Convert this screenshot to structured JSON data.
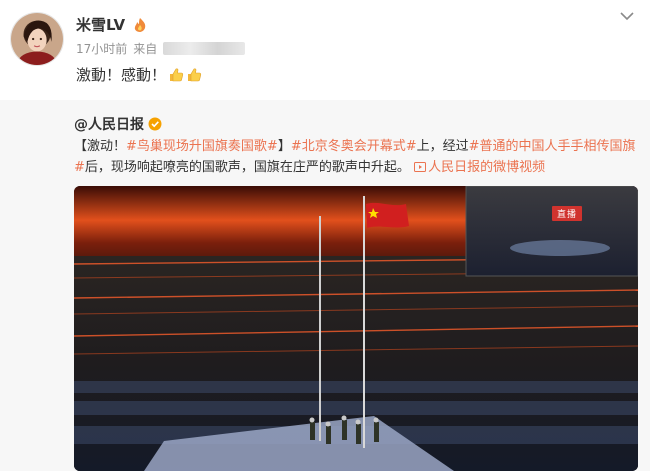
{
  "post": {
    "username": "米雪LV",
    "level_icon": "fire-level-icon",
    "time": "17小时前",
    "source_prefix": "来自",
    "text": "激動！感動！",
    "emoji": "thumbs-up-icon"
  },
  "repost": {
    "author": "@人民日报",
    "text_prefix": "【激动！",
    "topic1": "#鸟巢现场升国旗奏国歌#",
    "text_mid1": "】",
    "topic2": "#北京冬奥会开幕式#",
    "text_mid2": "上，经过",
    "topic3": "#普通的中国人手手相传国旗#",
    "text_mid3": "后，现场响起嘹亮的国歌声，国旗在庄严的歌声中升起。",
    "video_link": "人民日报的微博视频"
  },
  "media": {
    "live_label": "直播"
  },
  "colors": {
    "accent": "#eb7350",
    "verified": "#f6a100",
    "live": "#d0332e"
  }
}
